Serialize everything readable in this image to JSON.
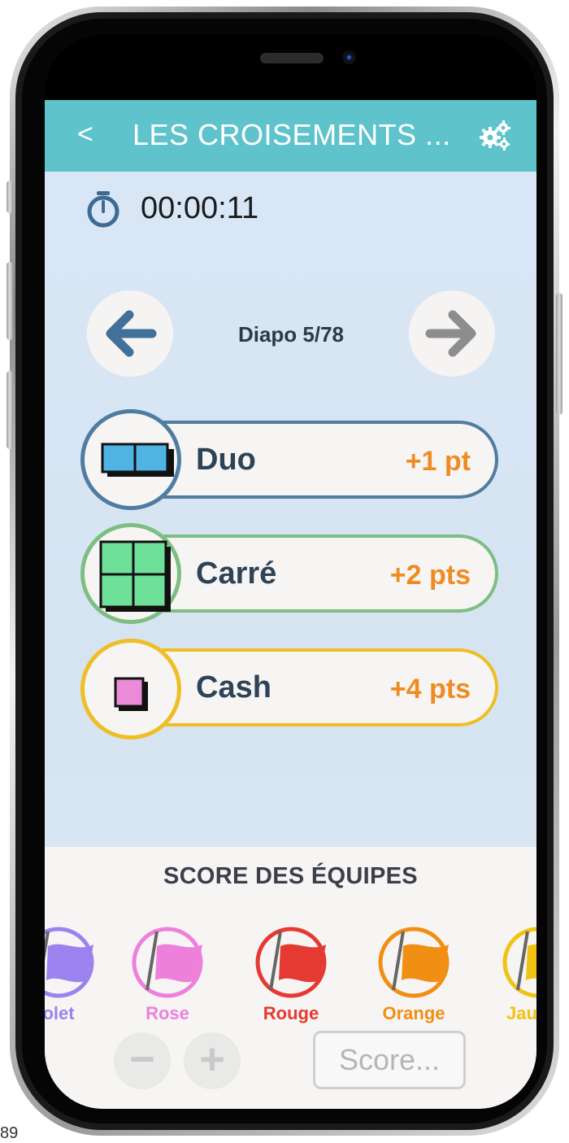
{
  "header": {
    "back_glyph": "<",
    "title": "LES CROISEMENTS ...",
    "settings_icon": "gears-icon"
  },
  "timer": {
    "value": "00:00:11",
    "icon": "stopwatch-icon"
  },
  "navigation": {
    "slide_label": "Diapo 5/78",
    "prev_icon": "arrow-left-icon",
    "next_icon": "arrow-right-icon"
  },
  "answers": [
    {
      "name": "Duo",
      "points": "+1 pt",
      "color": "#4f7ca1",
      "icon": "duo-icon"
    },
    {
      "name": "Carré",
      "points": "+2 pts",
      "color": "#7dbe82",
      "icon": "square-grid-icon"
    },
    {
      "name": "Cash",
      "points": "+4 pts",
      "color": "#efbd26",
      "icon": "cash-icon"
    }
  ],
  "teams_panel": {
    "title": "SCORE DES ÉQUIPES",
    "teams": [
      {
        "name": "olet",
        "color": "#9b82ee"
      },
      {
        "name": "Rose",
        "color": "#ee80dc"
      },
      {
        "name": "Rouge",
        "color": "#e53a32"
      },
      {
        "name": "Orange",
        "color": "#f18e14"
      },
      {
        "name": "Jau",
        "color": "#f0c313"
      }
    ],
    "minus_label": "−",
    "plus_label": "+",
    "score_placeholder": "Score..."
  },
  "footer": {
    "page_number": "89"
  }
}
